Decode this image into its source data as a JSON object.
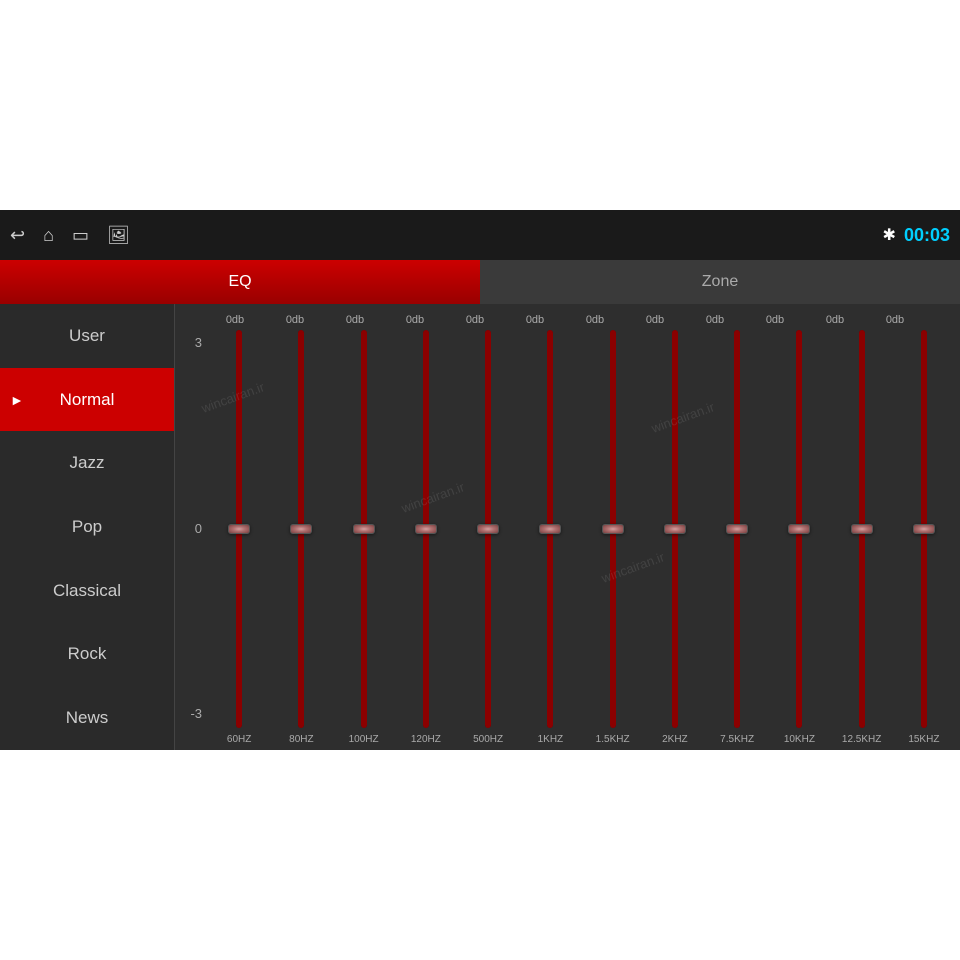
{
  "topbar": {
    "time": "00:03",
    "icons": {
      "back": "←",
      "home": "⌂",
      "screen": "▭",
      "image": "🖼"
    }
  },
  "tabs": [
    {
      "id": "eq",
      "label": "EQ",
      "active": true
    },
    {
      "id": "zone",
      "label": "Zone",
      "active": false
    }
  ],
  "sidebar": {
    "items": [
      {
        "id": "user",
        "label": "User",
        "active": false
      },
      {
        "id": "normal",
        "label": "Normal",
        "active": true
      },
      {
        "id": "jazz",
        "label": "Jazz",
        "active": false
      },
      {
        "id": "pop",
        "label": "Pop",
        "active": false
      },
      {
        "id": "classical",
        "label": "Classical",
        "active": false
      },
      {
        "id": "rock",
        "label": "Rock",
        "active": false
      },
      {
        "id": "news",
        "label": "News",
        "active": false
      }
    ]
  },
  "eq": {
    "scale": {
      "top": "3",
      "mid": "0",
      "bottom": "-3"
    },
    "bands": [
      {
        "freq": "60HZ",
        "db": "0db",
        "value": 0
      },
      {
        "freq": "80HZ",
        "db": "0db",
        "value": 0
      },
      {
        "freq": "100HZ",
        "db": "0db",
        "value": 0
      },
      {
        "freq": "120HZ",
        "db": "0db",
        "value": 0
      },
      {
        "freq": "500HZ",
        "db": "0db",
        "value": 0
      },
      {
        "freq": "1KHZ",
        "db": "0db",
        "value": 0
      },
      {
        "freq": "1.5KHZ",
        "db": "0db",
        "value": 0
      },
      {
        "freq": "2KHZ",
        "db": "0db",
        "value": 0
      },
      {
        "freq": "7.5KHZ",
        "db": "0db",
        "value": 0
      },
      {
        "freq": "10KHZ",
        "db": "0db",
        "value": 0
      },
      {
        "freq": "12.5KHZ",
        "db": "0db",
        "value": 0
      },
      {
        "freq": "15KHZ",
        "db": "0db",
        "value": 0
      }
    ]
  }
}
